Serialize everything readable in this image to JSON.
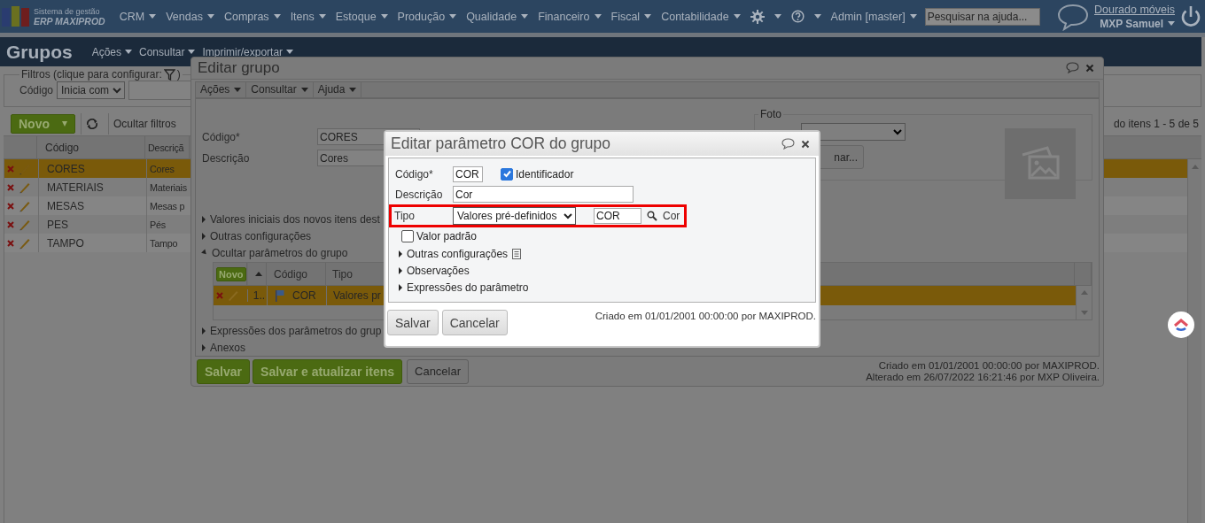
{
  "top_nav": {
    "brand_line1": "Sistema de gestão",
    "brand_line2": "ERP MAXIPROD",
    "menus": [
      "CRM",
      "Vendas",
      "Compras",
      "Itens",
      "Estoque",
      "Produção",
      "Qualidade",
      "Financeiro",
      "Fiscal",
      "Contabilidade"
    ],
    "user_menu": "Admin [master]",
    "search": {
      "placeholder": "Pesquisar na ajuda..."
    },
    "company": "Dourado móveis",
    "user": "MXP Samuel"
  },
  "page": {
    "title": "Grupos",
    "menus": [
      "Ações",
      "Consultar",
      "Imprimir/exportar"
    ]
  },
  "filters": {
    "legend": "Filtros (clique para configurar:",
    "legend_end": ")",
    "field_label": "Código",
    "operator": "Inicia com"
  },
  "toolbar": {
    "new_button": "Novo",
    "hide_filters": "Ocultar filtros",
    "paging": "do itens 1 - 5 de 5"
  },
  "table": {
    "columns": [
      "Código",
      "Descriçã"
    ],
    "rows": [
      {
        "code": "CORES",
        "description": "Cores",
        "selected": true
      },
      {
        "code": "MATERIAIS",
        "description": "Materiais",
        "selected": false
      },
      {
        "code": "MESAS",
        "description": "Mesas p",
        "selected": false
      },
      {
        "code": "PES",
        "description": "Pés",
        "selected": false
      },
      {
        "code": "TAMPO",
        "description": "Tampo",
        "selected": false
      }
    ]
  },
  "group_dialog": {
    "title": "Editar grupo",
    "menus": [
      "Ações",
      "Consultar",
      "Ajuda"
    ],
    "fields": [
      {
        "label": "Código*",
        "value": "CORES"
      },
      {
        "label": "Descrição",
        "value": "Cores"
      }
    ],
    "photo": {
      "legend": "Foto",
      "button": "nar..."
    },
    "sections": [
      {
        "label": "Valores iniciais dos novos itens dest",
        "expanded": false
      },
      {
        "label": "Outras configurações",
        "expanded": false
      },
      {
        "label": "Ocultar parâmetros do grupo",
        "expanded": true
      },
      {
        "label": "Expressões dos parâmetros do grup",
        "expanded": false
      },
      {
        "label": "Anexos",
        "expanded": false
      }
    ],
    "params_table": {
      "new_button": "Novo",
      "columns": [
        "Código",
        "Tipo"
      ],
      "rows": [
        {
          "order": "1..",
          "code": "COR",
          "type": "Valores pr",
          "selected": true
        }
      ]
    },
    "buttons": [
      {
        "label": "Salvar",
        "kind": "primary"
      },
      {
        "label": "Salvar e atualizar itens",
        "kind": "primary"
      },
      {
        "label": "Cancelar",
        "kind": "secondary"
      }
    ],
    "audit": [
      "Criado em 01/01/2001 00:00:00 por MAXIPROD.",
      "Alterado em 26/07/2022 16:21:46 por MXP Oliveira."
    ]
  },
  "param_dialog": {
    "title": "Editar parâmetro COR do grupo",
    "code_label": "Código*",
    "code": "COR",
    "identifier": {
      "label": "Identificador",
      "checked": true
    },
    "description_label": "Descrição",
    "description": "Cor",
    "type_label": "Tipo",
    "type_value": "Valores pré-definidos",
    "lookup_code": "COR",
    "lookup_name": "Cor",
    "type_row_highlighted": true,
    "default_value": {
      "label": "Valor padrão",
      "checked": false
    },
    "sections": [
      {
        "label": "Outras configurações",
        "expanded": false,
        "has_note_icon": true
      },
      {
        "label": "Observações",
        "expanded": false,
        "has_note_icon": false
      },
      {
        "label": "Expressões do parâmetro",
        "expanded": false,
        "has_note_icon": false
      }
    ],
    "buttons": [
      "Salvar",
      "Cancelar"
    ],
    "audit": "Criado em 01/01/2001 00:00:00 por MAXIPROD."
  }
}
